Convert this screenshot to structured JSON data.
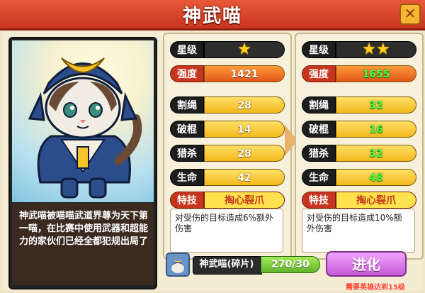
{
  "window": {
    "title": "神武喵",
    "close_glyph": "✕"
  },
  "portrait": {
    "description": "神武喵被喵喵武道界尊为天下第一喵，在比赛中使用武器和超能力的家伙们已经全都犯规出局了"
  },
  "current": {
    "rows": [
      {
        "label": "星级",
        "stars": 1
      },
      {
        "label": "强度",
        "value": "1421"
      },
      {
        "label": "割绳",
        "value": "28"
      },
      {
        "label": "破棍",
        "value": "14"
      },
      {
        "label": "猎杀",
        "value": "28"
      },
      {
        "label": "生命",
        "value": "42"
      }
    ],
    "skill_label": "特技",
    "skill_name": "掏心裂爪",
    "skill_desc": "对受伤的目标造成6%额外伤害"
  },
  "next": {
    "rows": [
      {
        "label": "星级",
        "stars": 2
      },
      {
        "label": "强度",
        "value": "1655"
      },
      {
        "label": "割绳",
        "value": "32"
      },
      {
        "label": "破棍",
        "value": "16"
      },
      {
        "label": "猎杀",
        "value": "32"
      },
      {
        "label": "生命",
        "value": "48"
      }
    ],
    "skill_label": "特技",
    "skill_name": "掏心裂爪",
    "skill_desc": "对受伤的目标造成10%额外伤害"
  },
  "shard": {
    "name": "神武喵(碎片)",
    "progress": "270/30"
  },
  "evolve_button": "进化",
  "requirement": "需要英雄达到15级",
  "colors": {
    "title_red": "#d9432a",
    "stat_yellow": "#f4b81d",
    "power_orange": "#e2571a",
    "green_up": "#4fff4a",
    "evolve_purple": "#c55bd6"
  }
}
